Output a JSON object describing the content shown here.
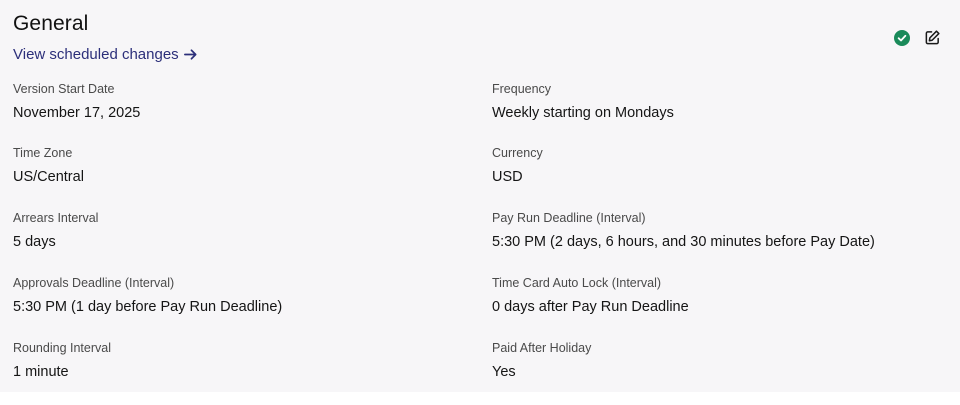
{
  "header": {
    "title": "General",
    "scheduled_link": "View scheduled changes",
    "status_color": "#1a8a5a",
    "link_color": "#2c2f7a"
  },
  "fields": {
    "left": [
      {
        "label": "Version Start Date",
        "value": "November 17, 2025"
      },
      {
        "label": "Time Zone",
        "value": "US/Central"
      },
      {
        "label": "Arrears Interval",
        "value": "5 days"
      },
      {
        "label": "Approvals Deadline (Interval)",
        "value": "5:30 PM (1 day before Pay Run Deadline)"
      },
      {
        "label": "Rounding Interval",
        "value": "1 minute"
      }
    ],
    "right": [
      {
        "label": "Frequency",
        "value": "Weekly starting on Mondays"
      },
      {
        "label": "Currency",
        "value": "USD"
      },
      {
        "label": "Pay Run Deadline (Interval)",
        "value": "5:30 PM (2 days, 6 hours, and 30 minutes before Pay Date)"
      },
      {
        "label": "Time Card Auto Lock (Interval)",
        "value": "0 days after Pay Run Deadline"
      },
      {
        "label": "Paid After Holiday",
        "value": "Yes"
      }
    ]
  },
  "icons": {
    "status": "check-circle-icon",
    "edit": "edit-icon",
    "link_arrow": "arrow-right-icon"
  }
}
